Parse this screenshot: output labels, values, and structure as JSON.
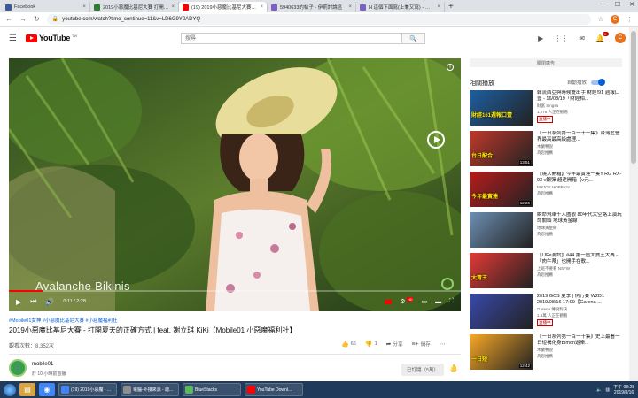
{
  "browser": {
    "tabs": [
      {
        "label": "Facebook",
        "color": "#3b5998",
        "active": false
      },
      {
        "label": "2019小惡魔比基尼大賽 打開夏天",
        "color": "#2e7d32",
        "active": false
      },
      {
        "label": "(19) 2019小惡魔比基尼大賽 - 打",
        "color": "#ff0000",
        "active": true
      },
      {
        "label": "5940633的帖子 - 伊莉討論區",
        "color": "#7b61c4",
        "active": false
      },
      {
        "label": "H 這個下面寫(上兼又寫) - 伊莉討",
        "color": "#7b61c4",
        "active": false
      }
    ],
    "new_tab": "+",
    "url": "youtube.com/watch?time_continue=11&v=LD6G9Y2ADYQ",
    "profile_letter": "C"
  },
  "youtube": {
    "logo": "YouTube",
    "logo_region": "TW",
    "search_placeholder": "搜尋",
    "notification_count": "9+",
    "avatar_letter": "C"
  },
  "player": {
    "overlay_text": "Avalanche Bikinis",
    "time": "0:11 / 2:28",
    "progress": 0.074,
    "hd": "HD"
  },
  "video": {
    "hashtags": "#Mobile01女神 #小惡魔比基尼大賽 #小惡魔福利社",
    "title": "2019小惡魔比基尼大賽 - 打開夏天的正確方式 | feat. 謝立琪 KiKi【Mobile01 小惡魔福利社】",
    "views": "觀看次數：8,352次",
    "likes": "66",
    "dislikes": "1",
    "share_label": "分享",
    "save_label": "儲存"
  },
  "channel": {
    "name": "mobile01",
    "published": "於 10 小時前首播",
    "subscribe_label": "已訂閱（5萬）"
  },
  "sidebar": {
    "ad_button": "關閉廣告",
    "up_next": "相關播放",
    "autoplay": "自動播放",
    "items": [
      {
        "title": "韓流西亞與時候雙出手 財經!91 週報口壹 - 16/08/19「財經相...",
        "channel": "財富 Singsa",
        "meta": "1,076 人正在觀看",
        "live": "直播中",
        "duration": "",
        "caption": "財經161週報口壹",
        "thumb": "#1e5fa0"
      },
      {
        "title": "《一日系列第一百一十一集》台灣藍營界最高最高級處理...",
        "channel": "木蘭鴨說",
        "meta": "為您推薦",
        "live": "",
        "duration": "13:51",
        "caption": "台日配合",
        "thumb": "#c0392b"
      },
      {
        "title": "【燒入開箱】今年最實達一隻!! RG RX-93 ν鋼彈 超達開箱【ν元...",
        "channel": "MRJOE HOBBY.tv",
        "meta": "為您推薦",
        "live": "",
        "duration": "12:26",
        "caption": "今年最實達",
        "thumb": "#b71c1c"
      },
      {
        "title": "瞬命飛車千人圍觀 80年代大空路上演玩命關頭 地球黃金線",
        "channel": "地球黃金線",
        "meta": "為您推薦",
        "live": "",
        "duration": "",
        "caption": "",
        "thumb": "#6d8fb3"
      },
      {
        "title": "【LIFe測試】#44 第一屆大寶王大賽 -「肉牛蒂」也開手在歌...",
        "channel": "上班不要看 NSFW",
        "meta": "為您推薦",
        "live": "",
        "duration": "",
        "caption": "大胃王",
        "thumb": "#e53935"
      },
      {
        "title": "2019 GCS 夏季 | 例行賽 W2D1 2019/08/16 17:00【Garena ...",
        "channel": "Garena 傳說對決",
        "meta": "1.6萬 人正在觀看",
        "live": "直播中",
        "duration": "",
        "caption": "",
        "thumb": "#3949ab"
      },
      {
        "title": "《一日系列第一百一十集》史上最看一日短褐化身Bimon遊樂...",
        "channel": "木蘭鴨說",
        "meta": "為您推薦",
        "live": "",
        "duration": "12:42",
        "caption": "一日短",
        "thumb": "#f9a825"
      }
    ]
  },
  "taskbar": {
    "tasks": [
      {
        "label": "(19) 2019小惡魔 - ...",
        "color": "#4285f4"
      },
      {
        "label": "電腦-外接來源 - 啟...",
        "color": "#8e8e8e"
      },
      {
        "label": "BlueStacks",
        "color": "#5bb85d"
      },
      {
        "label": "YouTube Downl...",
        "color": "#ff0000"
      }
    ],
    "time": "下午 08:28",
    "date": "2019/8/16"
  }
}
